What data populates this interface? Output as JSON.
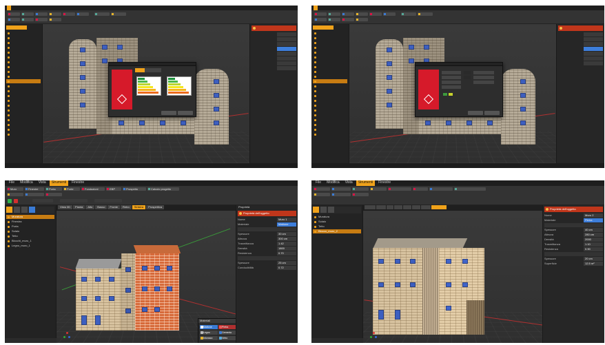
{
  "colors": {
    "accent": "#f0a21a",
    "selection": "#c77c12",
    "panel_header": "#c0361b",
    "window_blue": "#3d5fc0",
    "dialog_red": "#d61a2a"
  },
  "panel3": {
    "menu": [
      "File",
      "Modifica",
      "Vista",
      "Strumenti",
      "Finestre"
    ],
    "active_menu": "Strumenti",
    "ribbon": [
      "Muro",
      "Finestre",
      "Porta",
      "Porte",
      "Fondazioni",
      "EBP",
      "Prospetto",
      "Calcolo progetto"
    ],
    "tabs": [
      "Vista 3D",
      "Pianta",
      "Alto",
      "Basso",
      "Fronte",
      "Retro",
      "Sinistra",
      "Prospettiva",
      "Destra"
    ],
    "active_tab": "Sinistra",
    "sidebar_items": [
      "Muratura",
      "Finestra",
      "Porta",
      "Solaio",
      "Tetto",
      "Blocchi_muro_1",
      "Legno_muro_1"
    ],
    "properties_title": "Proprietà",
    "properties_header": "Proprietà dell'oggetto",
    "prop_rows": [
      {
        "k": "Nome",
        "v": "Muro 1"
      },
      {
        "k": "Materiale",
        "v": "Mattone"
      },
      {
        "k": "Spessore",
        "v": "30 cm"
      },
      {
        "k": "Altezza",
        "v": "300 cm"
      },
      {
        "k": "Trasmittanza",
        "v": "1.42"
      },
      {
        "k": "Densità",
        "v": "1800"
      },
      {
        "k": "Resistenza",
        "v": "0.70"
      },
      {
        "k": "Spessore",
        "v": "25 cm"
      },
      {
        "k": "Conducibilità",
        "v": "0.72"
      }
    ],
    "floating_panel_title": "Materiali",
    "chips": [
      "Mattone",
      "Pietra",
      "Legno",
      "Cemento",
      "Intonaco",
      "Vetro"
    ]
  },
  "panel4": {
    "menu": [
      "File",
      "Modifica",
      "Vista",
      "Strumenti",
      "Finestre"
    ],
    "active_menu": "Strumenti",
    "sidebar_items": [
      "Muratura",
      "Solaio",
      "Tetto",
      "Blocco_muro_2"
    ],
    "properties_header": "Proprietà dell'oggetto",
    "prop_rows": [
      {
        "k": "Nome",
        "v": "Muro 2"
      },
      {
        "k": "Materiale",
        "v": "Pietra"
      },
      {
        "k": "Spessore",
        "v": "40 cm"
      },
      {
        "k": "Altezza",
        "v": "280 cm"
      },
      {
        "k": "Densità",
        "v": "2000"
      },
      {
        "k": "Trasmittanza",
        "v": "1.10"
      },
      {
        "k": "Resistenza",
        "v": "0.90"
      },
      {
        "k": "Spessore",
        "v": "20 cm"
      },
      {
        "k": "Superficie",
        "v": "12.5 m²"
      }
    ]
  },
  "panel1": {
    "dialog_title": "Certificazione energetica"
  },
  "panel2": {
    "dialog_title": "Certificazione energetica"
  }
}
